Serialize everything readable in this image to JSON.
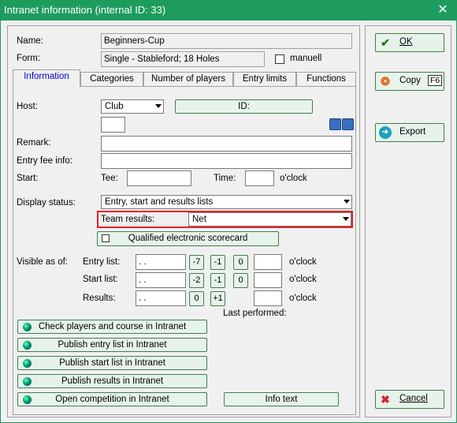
{
  "window": {
    "title": "Intranet information (internal ID: 33)",
    "close": "✕"
  },
  "fields": {
    "name_label": "Name:",
    "name_value": "Beginners-Cup",
    "form_label": "Form:",
    "form_value": "Single - Stableford; 18 Holes",
    "manual_label": "manuell"
  },
  "tabs": [
    "Information",
    "Categories",
    "Number of players",
    "Entry limits",
    "Functions"
  ],
  "info": {
    "host_label": "Host:",
    "host_value": "Club",
    "id_button": "ID:",
    "remark_label": "Remark:",
    "fee_label": "Entry fee info:",
    "start_label": "Start:",
    "tee_label": "Tee:",
    "time_label": "Time:",
    "oclock": "o'clock",
    "display_label": "Display status:",
    "display_value": "Entry, start and results lists",
    "team_label": "Team results:",
    "team_value": "Net",
    "scorecard_label": "Qualified electronic scorecard",
    "visible_label": "Visible as of:",
    "entry_list_label": "Entry list:",
    "start_list_label": "Start list:",
    "results_label": "Results:",
    "date_placeholder": " .  .",
    "entry_buttons": [
      "-7",
      "-1",
      "0"
    ],
    "start_buttons": [
      "-2",
      "-1",
      "0"
    ],
    "results_buttons": [
      "0",
      "+1"
    ],
    "last_performed": "Last performed:",
    "actions": [
      "Check players and course in Intranet",
      "Publish entry list in Intranet",
      "Publish start list in Intranet",
      "Publish results in Intranet",
      "Open competition in Intranet"
    ],
    "info_text": "Info text"
  },
  "side": {
    "ok": "OK",
    "copy": "Copy",
    "copy_key": "F6",
    "export": "Export",
    "cancel": "Cancel"
  },
  "colors": {
    "title_bar": "#1e9c5e",
    "highlight": "#e0202a",
    "tab_active": "#0000cc"
  }
}
